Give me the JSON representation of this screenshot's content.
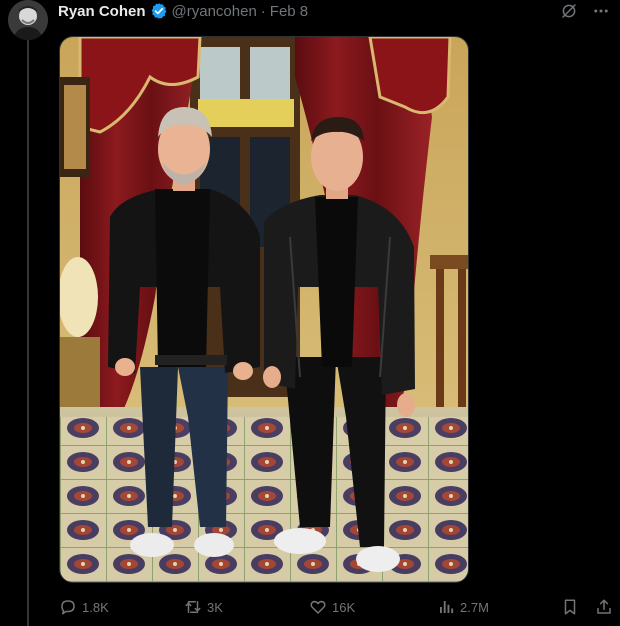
{
  "author": {
    "display_name": "Ryan Cohen",
    "handle": "@ryancohen",
    "separator": "·",
    "date": "Feb 8",
    "verified": true
  },
  "icons": {
    "verified": "verified-badge-icon",
    "grok": "grok-icon",
    "more": "more-icon",
    "reply": "reply-icon",
    "retweet": "retweet-icon",
    "like": "heart-icon",
    "views": "views-icon",
    "bookmark": "bookmark-icon",
    "share": "share-icon"
  },
  "media": {
    "type": "photo",
    "description_hint": "Two men standing side by side in an ornate room with red curtains and patterned tile floor"
  },
  "actions": {
    "replies": "1.8K",
    "retweets": "3K",
    "likes": "16K",
    "views": "2.7M"
  },
  "colors": {
    "background": "#000000",
    "text_primary": "#e7e9ea",
    "text_secondary": "#71767b",
    "verified_blue": "#1d9bf0"
  }
}
